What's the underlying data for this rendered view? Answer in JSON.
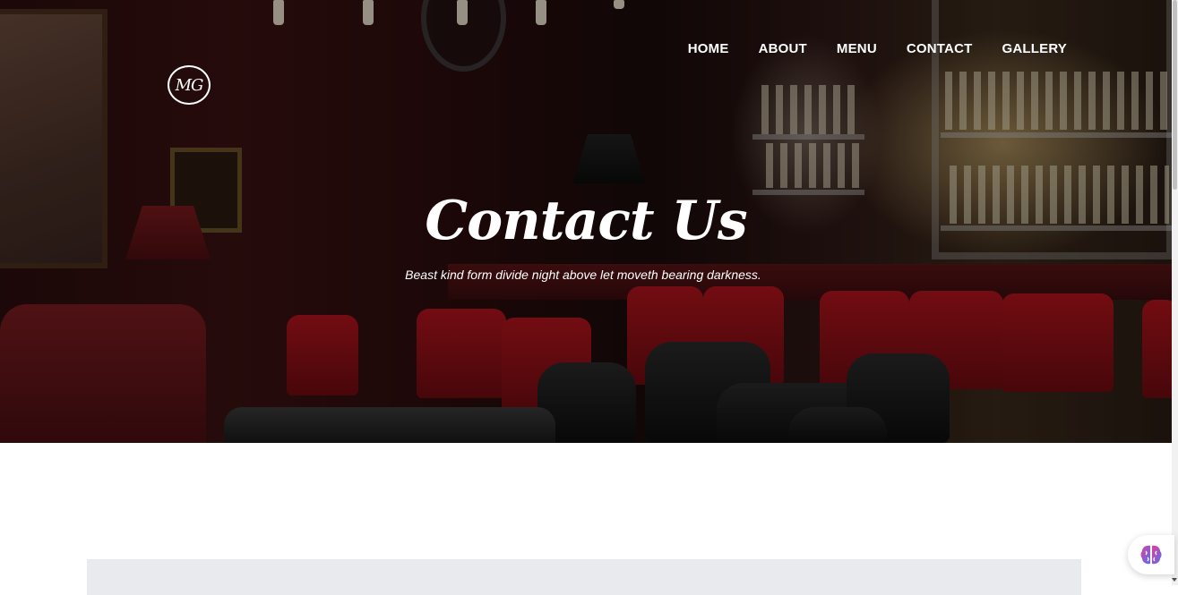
{
  "brand": {
    "logo_text": "MG"
  },
  "nav": {
    "items": [
      {
        "label": "HOME"
      },
      {
        "label": "ABOUT"
      },
      {
        "label": "MENU"
      },
      {
        "label": "CONTACT"
      },
      {
        "label": "GALLERY"
      }
    ]
  },
  "hero": {
    "title": "Contact Us",
    "subtitle": "Beast kind form divide night above let moveth bearing darkness."
  },
  "widget": {
    "icon": "brain-icon"
  },
  "colors": {
    "text_on_hero": "#ffffff",
    "content_box": "#e9eaed",
    "widget_icon_pink": "#e0409a",
    "widget_icon_blue": "#5b6cf0"
  }
}
